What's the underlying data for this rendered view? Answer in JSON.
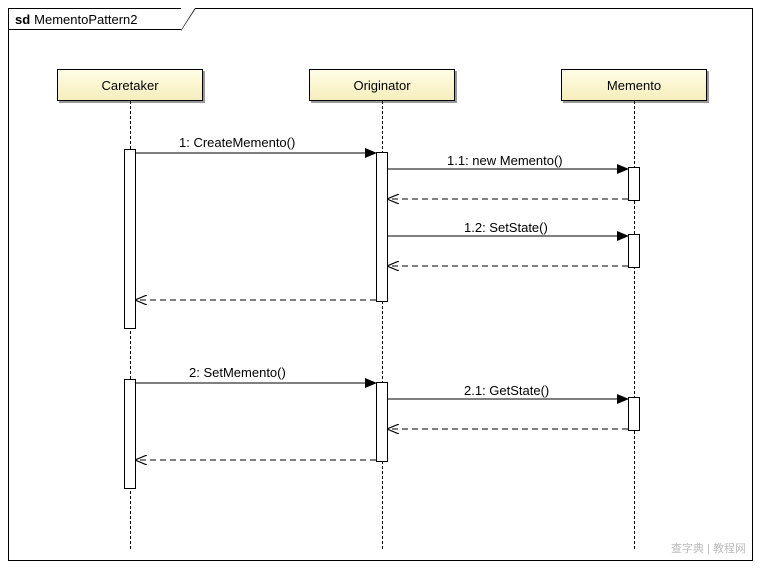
{
  "frame": {
    "prefix": "sd",
    "name": "MementoPattern2"
  },
  "participants": {
    "caretaker": "Caretaker",
    "originator": "Originator",
    "memento": "Memento"
  },
  "messages": {
    "m1": "1: CreateMemento()",
    "m11": "1.1: new Memento()",
    "m12": "1.2: SetState()",
    "m2": "2: SetMemento()",
    "m21": "2.1: GetState()"
  },
  "watermark": "查字典 | 教程网",
  "chart_data": {
    "type": "sequence_diagram",
    "frame": "sd MementoPattern2",
    "participants": [
      "Caretaker",
      "Originator",
      "Memento"
    ],
    "messages": [
      {
        "seq": "1",
        "from": "Caretaker",
        "to": "Originator",
        "label": "CreateMemento()",
        "kind": "call"
      },
      {
        "seq": "1.1",
        "from": "Originator",
        "to": "Memento",
        "label": "new Memento()",
        "kind": "call"
      },
      {
        "from": "Memento",
        "to": "Originator",
        "kind": "return"
      },
      {
        "seq": "1.2",
        "from": "Originator",
        "to": "Memento",
        "label": "SetState()",
        "kind": "call"
      },
      {
        "from": "Memento",
        "to": "Originator",
        "kind": "return"
      },
      {
        "from": "Originator",
        "to": "Caretaker",
        "kind": "return"
      },
      {
        "seq": "2",
        "from": "Caretaker",
        "to": "Originator",
        "label": "SetMemento()",
        "kind": "call"
      },
      {
        "seq": "2.1",
        "from": "Originator",
        "to": "Memento",
        "label": "GetState()",
        "kind": "call"
      },
      {
        "from": "Memento",
        "to": "Originator",
        "kind": "return"
      },
      {
        "from": "Originator",
        "to": "Caretaker",
        "kind": "return"
      }
    ]
  }
}
